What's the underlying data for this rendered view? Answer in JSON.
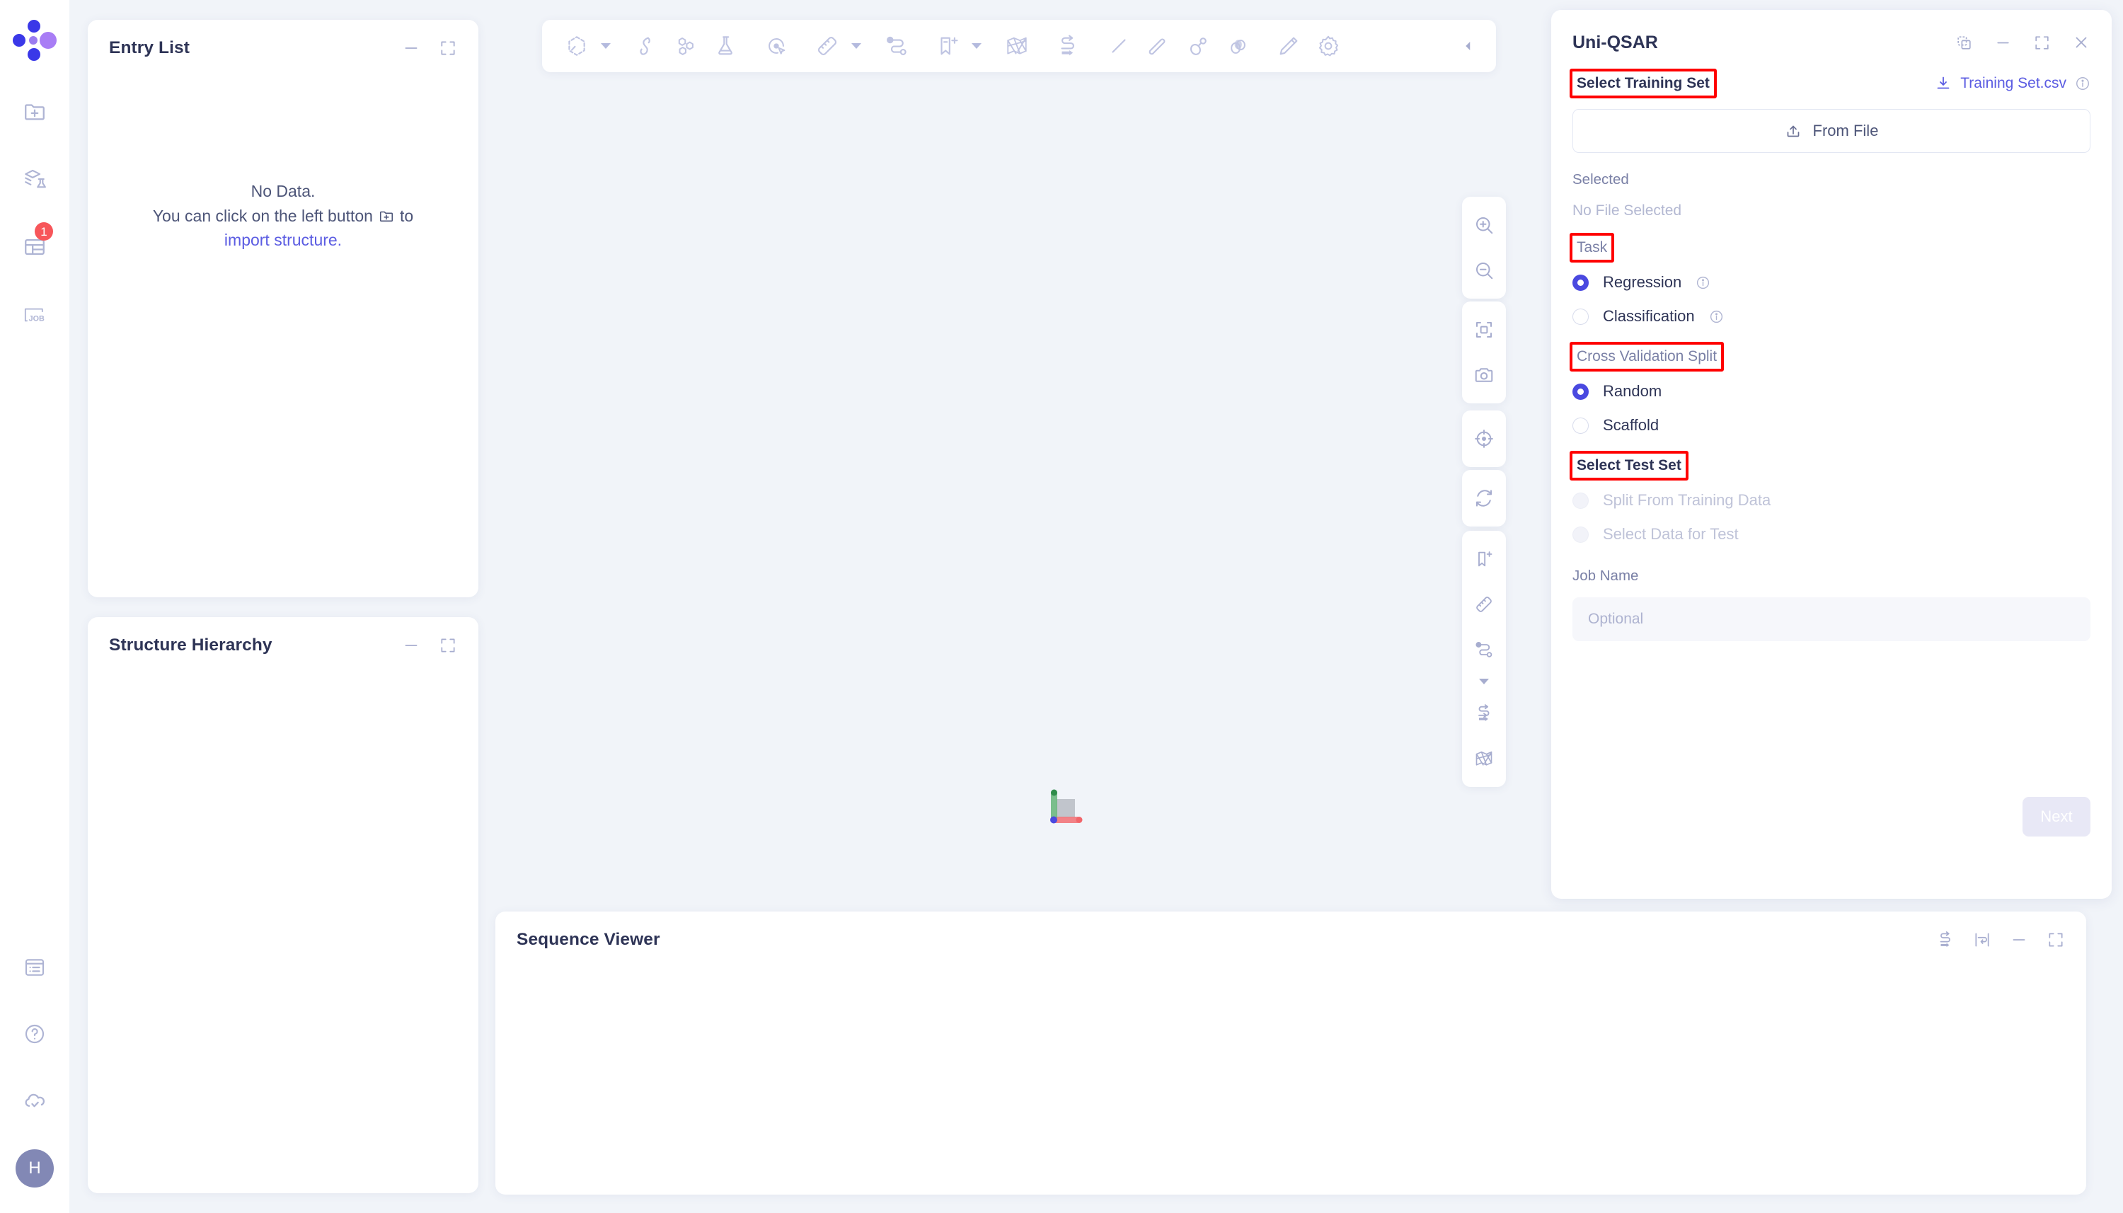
{
  "rail": {
    "logo": "uni-mol-logo",
    "items": [
      {
        "name": "import-structure",
        "icon": "folder-plus-icon",
        "badge": null
      },
      {
        "name": "datasets-lab",
        "icon": "layers-flask-icon",
        "badge": null
      },
      {
        "name": "tables",
        "icon": "table-icon",
        "badge": "1"
      },
      {
        "name": "jobs",
        "icon": "job-icon",
        "badge": null,
        "text": "JOB"
      }
    ],
    "bottom": [
      {
        "name": "notes",
        "icon": "list-panel-icon"
      },
      {
        "name": "help",
        "icon": "question-circle-icon"
      },
      {
        "name": "cloud-sync",
        "icon": "cloud-check-icon"
      }
    ],
    "avatar_initial": "H"
  },
  "entry_list": {
    "title": "Entry List",
    "empty_line1": "No Data.",
    "empty_line2_pre": "You can click on the left button",
    "empty_line2_post": "to",
    "empty_link": "import structure.",
    "tools": [
      {
        "name": "minimize-button",
        "icon": "minus-icon"
      },
      {
        "name": "maximize-button",
        "icon": "expand-icon"
      }
    ]
  },
  "structure_hierarchy": {
    "title": "Structure Hierarchy",
    "tools": [
      {
        "name": "minimize-button",
        "icon": "minus-icon"
      },
      {
        "name": "maximize-button",
        "icon": "expand-icon"
      }
    ]
  },
  "toolbar": {
    "items": [
      {
        "name": "benzene-ring-tool",
        "icon": "hexagon-icon",
        "caret": true
      },
      {
        "name": "protein-ribbon-tool",
        "icon": "ribbon-icon",
        "caret": false
      },
      {
        "name": "molecule-tool",
        "icon": "molecule-icon",
        "caret": false
      },
      {
        "name": "experiment-flask-tool",
        "icon": "flask-icon",
        "caret": false
      },
      {
        "name": "select-pointer-tool",
        "icon": "target-cursor-icon",
        "caret": false
      },
      {
        "name": "measure-tool",
        "icon": "ruler-icon",
        "caret": true
      },
      {
        "name": "path-tool",
        "icon": "path-node-icon",
        "caret": false
      },
      {
        "name": "bookmark-add-tool",
        "icon": "bookmark-plus-icon",
        "caret": true
      },
      {
        "name": "surface-mesh-tool",
        "icon": "mesh-surface-icon",
        "caret": false
      },
      {
        "name": "swap-arrows-tool",
        "icon": "swap-arrows-icon",
        "caret": false
      },
      {
        "name": "line-tool",
        "icon": "line-icon",
        "caret": false
      },
      {
        "name": "stick-tool",
        "icon": "stick-bond-icon",
        "caret": false
      },
      {
        "name": "ball-stick-tool",
        "icon": "ball-stick-icon",
        "caret": false
      },
      {
        "name": "sphere-tool",
        "icon": "spheres-icon",
        "caret": false
      },
      {
        "name": "pencil-edit-tool",
        "icon": "pencil-icon",
        "caret": false
      },
      {
        "name": "settings-tool",
        "icon": "gear-icon",
        "caret": false
      }
    ],
    "collapse": {
      "name": "collapse-toolbar-button",
      "icon": "chevron-left-icon"
    }
  },
  "canvas_tools": {
    "group1": [
      {
        "name": "zoom-in-button",
        "icon": "zoom-in-icon"
      },
      {
        "name": "zoom-out-button",
        "icon": "zoom-out-icon"
      }
    ],
    "group2": [
      {
        "name": "fit-to-screen-button",
        "icon": "fit-screen-icon"
      },
      {
        "name": "screenshot-button",
        "icon": "camera-icon"
      }
    ],
    "group3": [
      {
        "name": "center-target-button",
        "icon": "crosshair-icon"
      }
    ],
    "group4": [
      {
        "name": "reset-rotation-button",
        "icon": "refresh-icon"
      }
    ],
    "group5": [
      {
        "name": "bookmark-add-button",
        "icon": "bookmark-plus-icon"
      },
      {
        "name": "measure-button",
        "icon": "ruler-icon"
      },
      {
        "name": "path-button",
        "icon": "path-node-icon",
        "caret": true
      },
      {
        "name": "swap-arrows-button",
        "icon": "swap-arrows-icon"
      },
      {
        "name": "mesh-surface-button",
        "icon": "mesh-surface-icon"
      }
    ]
  },
  "axis_widget": {
    "x_color": "#f2656a",
    "y_color": "#5cb071",
    "z_color": "#4a49e0"
  },
  "sequence_viewer": {
    "title": "Sequence Viewer",
    "tools": [
      {
        "name": "swap-arrows-button",
        "icon": "swap-arrows-icon"
      },
      {
        "name": "wrap-lines-button",
        "icon": "wrap-lines-icon"
      },
      {
        "name": "minimize-button",
        "icon": "minus-icon"
      },
      {
        "name": "maximize-button",
        "icon": "expand-icon"
      }
    ]
  },
  "qsar": {
    "title": "Uni-QSAR",
    "tools": [
      {
        "name": "duplicate-button",
        "icon": "copy-icon"
      },
      {
        "name": "minimize-button",
        "icon": "minus-icon"
      },
      {
        "name": "maximize-button",
        "icon": "expand-icon"
      },
      {
        "name": "close-button",
        "icon": "close-icon"
      }
    ],
    "select_training_set_label": "Select Training Set",
    "training_set_link": "Training Set.csv",
    "from_file_label": "From File",
    "selected_label": "Selected",
    "no_file_selected": "No File Selected",
    "task_label": "Task",
    "task_options": [
      {
        "label": "Regression",
        "checked": true,
        "info": true,
        "disabled": false
      },
      {
        "label": "Classification",
        "checked": false,
        "info": true,
        "disabled": false
      }
    ],
    "cv_split_label": "Cross Validation Split",
    "cv_options": [
      {
        "label": "Random",
        "checked": true,
        "info": false,
        "disabled": false
      },
      {
        "label": "Scaffold",
        "checked": false,
        "info": false,
        "disabled": false
      }
    ],
    "select_test_set_label": "Select Test Set",
    "test_options": [
      {
        "label": "Split From Training Data",
        "checked": false,
        "info": false,
        "disabled": true
      },
      {
        "label": "Select Data for Test",
        "checked": false,
        "info": false,
        "disabled": true
      }
    ],
    "job_name_label": "Job Name",
    "job_name_value": "",
    "job_name_placeholder": "Optional",
    "next_label": "Next",
    "accent_color": "#4a49e0",
    "highlight_color": "#ff0000"
  }
}
